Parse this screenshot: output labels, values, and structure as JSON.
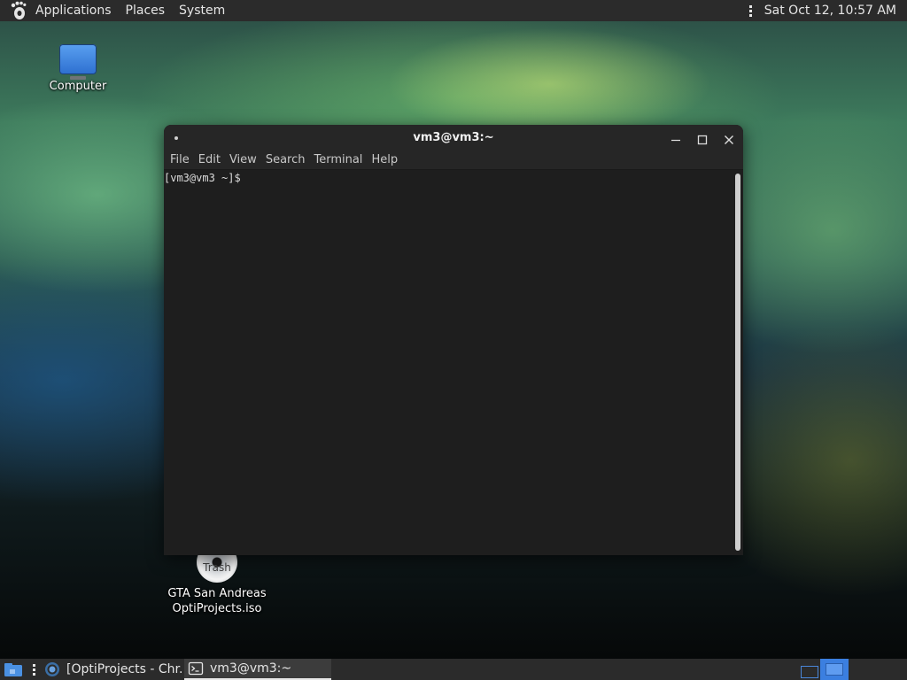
{
  "top_panel": {
    "logo_icon": "gnome-foot-icon",
    "menus": [
      "Applications",
      "Places",
      "System"
    ],
    "clock": "Sat Oct 12, 10:57 AM"
  },
  "desktop": {
    "icons": [
      {
        "label": "Computer",
        "icon": "monitor-icon"
      },
      {
        "label_lines": [
          "GTA San Andreas",
          "OptiProjects.iso"
        ],
        "overlay_text": "Trash",
        "icon": "disc-icon"
      }
    ]
  },
  "terminal": {
    "title": "vm3@vm3:~",
    "menu": [
      "File",
      "Edit",
      "View",
      "Search",
      "Terminal",
      "Help"
    ],
    "prompt": "[vm3@vm3 ~]$",
    "buttons": [
      "minimize-icon",
      "maximize-icon",
      "close-icon"
    ]
  },
  "bottom_panel": {
    "tasks": [
      {
        "label": "[OptiProjects - Chr...",
        "icon": "chrome-icon",
        "active": false
      },
      {
        "label": "vm3@vm3:~",
        "icon": "terminal-icon",
        "active": true
      }
    ],
    "workspaces": 2,
    "active_workspace": 2
  },
  "colors": {
    "panel_bg": "#2b2b2b",
    "terminal_bg": "#1e1e1e",
    "accent": "#3b7fe0"
  }
}
